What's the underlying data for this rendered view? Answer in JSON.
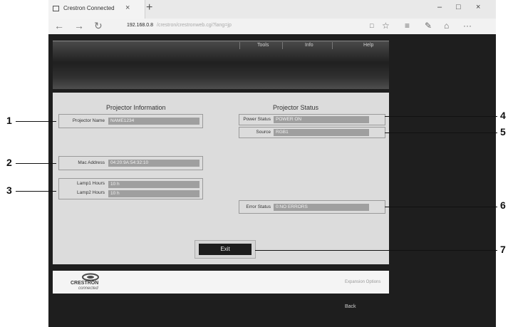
{
  "browser": {
    "tab_title": "Crestron Connected",
    "tab_close": "×",
    "new_tab": "+",
    "minimize": "–",
    "maximize": "□",
    "close": "×",
    "url_host": "192.168.0.8",
    "url_path": "/crestron/crestronweb.cgi?lang=jp",
    "back": "←",
    "forward": "→",
    "refresh": "↻",
    "reading_view": "□",
    "favorite": "☆",
    "hub": "≡",
    "notes": "✎",
    "share": "⌂",
    "more": "···"
  },
  "menu": {
    "tools": "Tools",
    "info": "Info",
    "help": "Help"
  },
  "projector_info": {
    "title": "Projector Information",
    "name_label": "Projector Name",
    "name_value": "NAME1234",
    "mac_label": "Mac Address",
    "mac_value": "04:20:9A:54:32:10",
    "lamp1_label": "Lamp1 Hours",
    "lamp1_value": "10 h",
    "lamp2_label": "Lamp2 Hours",
    "lamp2_value": "10 h"
  },
  "projector_status": {
    "title": "Projector Status",
    "power_label": "Power Status",
    "power_value": "POWER ON",
    "source_label": "Source",
    "source_value": "RGB1",
    "error_label": "Error Status",
    "error_value": "0:NO ERRORS"
  },
  "exit_label": "Exit",
  "footer": {
    "logo_main": "CRESTRON",
    "logo_sub": "connected",
    "expansion_options": "Expansion Options"
  },
  "back_label": "Back",
  "callouts": [
    "1",
    "2",
    "3",
    "4",
    "5",
    "6",
    "7"
  ]
}
